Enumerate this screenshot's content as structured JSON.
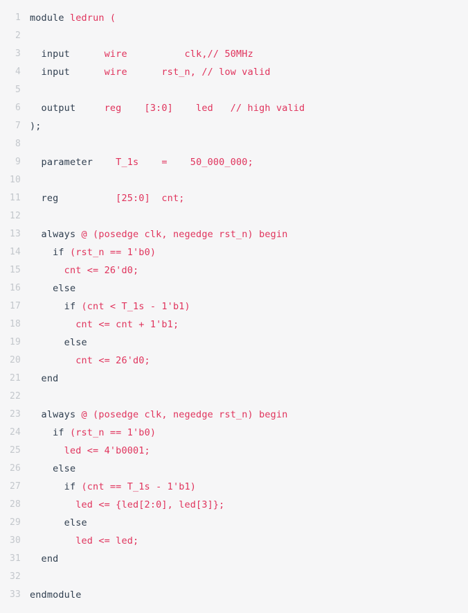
{
  "editor": {
    "language": "verilog",
    "background_color": "#f6f6f7",
    "gutter_color": "#c3c7cc",
    "keyword_color": "#2f3e4f",
    "identifier_color": "#e0335c",
    "total_lines": 33
  },
  "lines": [
    {
      "n": "1",
      "tokens": [
        {
          "t": "kw",
          "v": "module "
        },
        {
          "t": "id",
          "v": "ledrun ("
        }
      ]
    },
    {
      "n": "2",
      "tokens": []
    },
    {
      "n": "3",
      "tokens": [
        {
          "t": "kw",
          "v": "  input      "
        },
        {
          "t": "id",
          "v": "wire          clk,// 50MHz"
        }
      ]
    },
    {
      "n": "4",
      "tokens": [
        {
          "t": "kw",
          "v": "  input      "
        },
        {
          "t": "id",
          "v": "wire      rst_n, // low valid"
        }
      ]
    },
    {
      "n": "5",
      "tokens": []
    },
    {
      "n": "6",
      "tokens": [
        {
          "t": "kw",
          "v": "  output   "
        },
        {
          "t": "id",
          "v": "  reg    [3:0]    led   // high valid"
        }
      ]
    },
    {
      "n": "7",
      "tokens": [
        {
          "t": "plain",
          "v": ");"
        }
      ]
    },
    {
      "n": "8",
      "tokens": []
    },
    {
      "n": "9",
      "tokens": [
        {
          "t": "kw",
          "v": "  parameter  "
        },
        {
          "t": "id",
          "v": "  T_1s    =    50_000_000;"
        }
      ]
    },
    {
      "n": "10",
      "tokens": []
    },
    {
      "n": "11",
      "tokens": [
        {
          "t": "kw",
          "v": "  reg        "
        },
        {
          "t": "id",
          "v": "  [25:0]  cnt;"
        }
      ]
    },
    {
      "n": "12",
      "tokens": []
    },
    {
      "n": "13",
      "tokens": [
        {
          "t": "kw",
          "v": "  always "
        },
        {
          "t": "id",
          "v": "@ (posedge clk, negedge rst_n) begin"
        }
      ]
    },
    {
      "n": "14",
      "tokens": [
        {
          "t": "kw",
          "v": "    if "
        },
        {
          "t": "id",
          "v": "(rst_n == 1'b0)"
        }
      ]
    },
    {
      "n": "15",
      "tokens": [
        {
          "t": "id",
          "v": "      cnt <= 26'd0;"
        }
      ]
    },
    {
      "n": "16",
      "tokens": [
        {
          "t": "kw",
          "v": "    else"
        }
      ]
    },
    {
      "n": "17",
      "tokens": [
        {
          "t": "kw",
          "v": "      if "
        },
        {
          "t": "id",
          "v": "(cnt < T_1s - 1'b1)"
        }
      ]
    },
    {
      "n": "18",
      "tokens": [
        {
          "t": "id",
          "v": "        cnt <= cnt + 1'b1;"
        }
      ]
    },
    {
      "n": "19",
      "tokens": [
        {
          "t": "kw",
          "v": "      else"
        }
      ]
    },
    {
      "n": "20",
      "tokens": [
        {
          "t": "id",
          "v": "        cnt <= 26'd0;"
        }
      ]
    },
    {
      "n": "21",
      "tokens": [
        {
          "t": "kw",
          "v": "  end"
        }
      ]
    },
    {
      "n": "22",
      "tokens": []
    },
    {
      "n": "23",
      "tokens": [
        {
          "t": "kw",
          "v": "  always "
        },
        {
          "t": "id",
          "v": "@ (posedge clk, negedge rst_n) begin"
        }
      ]
    },
    {
      "n": "24",
      "tokens": [
        {
          "t": "kw",
          "v": "    if "
        },
        {
          "t": "id",
          "v": "(rst_n == 1'b0)"
        }
      ]
    },
    {
      "n": "25",
      "tokens": [
        {
          "t": "id",
          "v": "      led <= 4'b0001;"
        }
      ]
    },
    {
      "n": "26",
      "tokens": [
        {
          "t": "kw",
          "v": "    else"
        }
      ]
    },
    {
      "n": "27",
      "tokens": [
        {
          "t": "kw",
          "v": "      if "
        },
        {
          "t": "id",
          "v": "(cnt == T_1s - 1'b1)"
        }
      ]
    },
    {
      "n": "28",
      "tokens": [
        {
          "t": "id",
          "v": "        led <= {led[2:0], led[3]};"
        }
      ]
    },
    {
      "n": "29",
      "tokens": [
        {
          "t": "kw",
          "v": "      else"
        }
      ]
    },
    {
      "n": "30",
      "tokens": [
        {
          "t": "id",
          "v": "        led <= led;"
        }
      ]
    },
    {
      "n": "31",
      "tokens": [
        {
          "t": "kw",
          "v": "  end"
        }
      ]
    },
    {
      "n": "32",
      "tokens": []
    },
    {
      "n": "33",
      "tokens": [
        {
          "t": "kw",
          "v": "endmodule"
        }
      ]
    }
  ]
}
